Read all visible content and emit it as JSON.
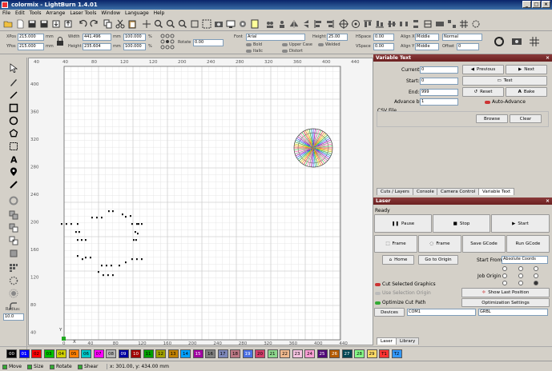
{
  "window": {
    "title": "colormix - LightBurn 1.4.01"
  },
  "menu": [
    "File",
    "Edit",
    "Tools",
    "Arrange",
    "Laser Tools",
    "Window",
    "Language",
    "Help"
  ],
  "props": {
    "xpos_label": "XPos",
    "xpos": "215.000",
    "ypos_label": "YPos",
    "ypos": "215.000",
    "unit": "mm",
    "width_label": "Width",
    "width": "441.496",
    "height_label": "Height",
    "height": "235.604",
    "scale_w": "100.000",
    "scale_h": "100.000",
    "pct": "%",
    "rotate_label": "Rotate",
    "rotate": "0.00",
    "font_label": "Font",
    "font": "Arial",
    "fheight_label": "Height",
    "fheight": "25.00",
    "bold": "Bold",
    "italic": "Italic",
    "upper": "Upper Case",
    "distort": "Distort",
    "welded": "Welded",
    "hspace_label": "HSpace",
    "hspace": "0.00",
    "vspace_label": "VSpace",
    "vspace": "0.00",
    "alignx_label": "Align X",
    "alignx": "Middle",
    "aligny_label": "Align Y",
    "aligny": "Middle",
    "normal": "Normal",
    "offset_label": "Offset",
    "offset": "0"
  },
  "canvas": {
    "top_ticks": [
      "40",
      "40",
      "80",
      "120",
      "120",
      "200",
      "240",
      "280",
      "320",
      "360",
      "400",
      "440"
    ],
    "left_ticks": [
      "400",
      "360",
      "320",
      "280",
      "240",
      "200",
      "160",
      "120",
      "80",
      "40"
    ],
    "bottom_ticks": [
      "0",
      "40",
      "80",
      "120",
      "160",
      "200",
      "240",
      "280",
      "320",
      "360",
      "400",
      "440"
    ],
    "x_mark": "X",
    "y_mark": "Y"
  },
  "variable_text": {
    "title": "Variable Text",
    "current_label": "Current:",
    "current": "0",
    "start_label": "Start:",
    "start": "0",
    "end_label": "End:",
    "end": "999",
    "advance_label": "Advance by:",
    "advance": "1",
    "previous": "Previous",
    "next": "Next",
    "test": "Test",
    "reset": "Reset",
    "bake": "Bake",
    "auto_advance": "Auto-Advance",
    "csv_label": "CSV File",
    "browse": "Browse",
    "clear": "Clear"
  },
  "tabs_top": [
    "Cuts / Layers",
    "Console",
    "Camera Control",
    "Variable Text"
  ],
  "laser": {
    "title": "Laser",
    "status": "Ready",
    "pause": "Pause",
    "stop": "Stop",
    "start": "Start",
    "frame1": "Frame",
    "frame2": "Frame",
    "save_gcode": "Save GCode",
    "run_gcode": "Run GCode",
    "home": "Home",
    "goto_origin": "Go to Origin",
    "start_from_label": "Start From:",
    "start_from": "Absolute Coords",
    "job_origin": "Job Origin",
    "cut_selected": "Cut Selected Graphics",
    "use_selection": "Use Selection Origin",
    "show_last": "Show Last Position",
    "optimize": "Optimize Cut Path",
    "opt_settings": "Optimization Settings",
    "devices": "Devices",
    "port": "COM1",
    "controller": "GRBL"
  },
  "tabs_bottom": [
    "Laser",
    "Library"
  ],
  "left": {
    "radius_label": "Radius:",
    "radius": "10.0"
  },
  "palette": [
    {
      "l": "00",
      "c": "#000000",
      "t": "#fff"
    },
    {
      "l": "01",
      "c": "#0000ff",
      "t": "#fff"
    },
    {
      "l": "02",
      "c": "#ff0000",
      "t": "#000"
    },
    {
      "l": "03",
      "c": "#00c000",
      "t": "#000"
    },
    {
      "l": "04",
      "c": "#d0d000",
      "t": "#000"
    },
    {
      "l": "05",
      "c": "#ff8000",
      "t": "#000"
    },
    {
      "l": "06",
      "c": "#00c8c8",
      "t": "#000"
    },
    {
      "l": "07",
      "c": "#ff00ff",
      "t": "#000"
    },
    {
      "l": "08",
      "c": "#b4b4b4",
      "t": "#000"
    },
    {
      "l": "09",
      "c": "#0000a0",
      "t": "#fff"
    },
    {
      "l": "10",
      "c": "#a00000",
      "t": "#fff"
    },
    {
      "l": "11",
      "c": "#00a000",
      "t": "#000"
    },
    {
      "l": "12",
      "c": "#a0a000",
      "t": "#000"
    },
    {
      "l": "13",
      "c": "#c08000",
      "t": "#000"
    },
    {
      "l": "14",
      "c": "#00a0ff",
      "t": "#000"
    },
    {
      "l": "15",
      "c": "#a000a0",
      "t": "#fff"
    },
    {
      "l": "16",
      "c": "#808080",
      "t": "#000"
    },
    {
      "l": "17",
      "c": "#7d87b9",
      "t": "#000"
    },
    {
      "l": "18",
      "c": "#bb7784",
      "t": "#000"
    },
    {
      "l": "19",
      "c": "#4a6fe3",
      "t": "#fff"
    },
    {
      "l": "20",
      "c": "#d33f6a",
      "t": "#000"
    },
    {
      "l": "21",
      "c": "#8cd78c",
      "t": "#000"
    },
    {
      "l": "22",
      "c": "#f0b98d",
      "t": "#000"
    },
    {
      "l": "23",
      "c": "#f6c4e1",
      "t": "#000"
    },
    {
      "l": "24",
      "c": "#fa9ed4",
      "t": "#000"
    },
    {
      "l": "25",
      "c": "#500a78",
      "t": "#fff"
    },
    {
      "l": "26",
      "c": "#b45a00",
      "t": "#fff"
    },
    {
      "l": "27",
      "c": "#004754",
      "t": "#fff"
    },
    {
      "l": "28",
      "c": "#86fa88",
      "t": "#000"
    },
    {
      "l": "29",
      "c": "#ffdb66",
      "t": "#000"
    },
    {
      "l": "T1",
      "c": "#f33",
      "t": "#000"
    },
    {
      "l": "T2",
      "c": "#39f",
      "t": "#000"
    }
  ],
  "status": {
    "move": "Move",
    "size": "Size",
    "rotate": "Rotate",
    "shear": "Shear",
    "coords": "x: 301.00, y: 434.00 mm"
  }
}
